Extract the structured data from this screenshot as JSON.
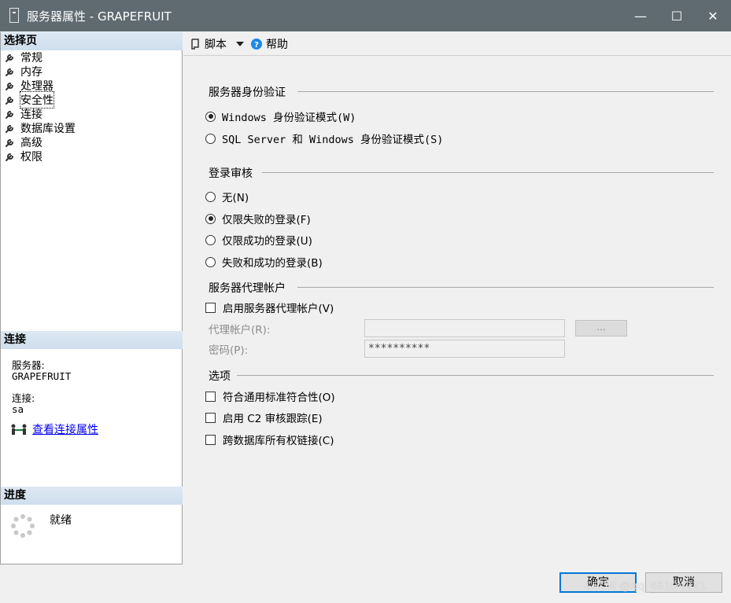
{
  "window": {
    "title": "服务器属性 - GRAPEFRUIT",
    "controls": {
      "minimize": "—",
      "maximize": "☐",
      "close": "✕"
    }
  },
  "left": {
    "select_page_header": "选择页",
    "pages": [
      {
        "label": "常规",
        "icon": "wrench-icon"
      },
      {
        "label": "内存",
        "icon": "wrench-icon"
      },
      {
        "label": "处理器",
        "icon": "wrench-icon"
      },
      {
        "label": "安全性",
        "icon": "wrench-icon",
        "selected": true
      },
      {
        "label": "连接",
        "icon": "wrench-icon"
      },
      {
        "label": "数据库设置",
        "icon": "wrench-icon"
      },
      {
        "label": "高级",
        "icon": "wrench-icon"
      },
      {
        "label": "权限",
        "icon": "wrench-icon"
      }
    ],
    "connection_header": "连接",
    "server_label": "服务器:",
    "server_value": "GRAPEFRUIT",
    "connection_label": "连接:",
    "connection_value": "sa",
    "view_connection_link": "查看连接属性",
    "progress_header": "进度",
    "progress_status": "就绪"
  },
  "toolbar": {
    "script_label": "脚本",
    "help_label": "帮助"
  },
  "security": {
    "auth_group": "服务器身份验证",
    "auth_options": [
      {
        "label": "Windows 身份验证模式(W)",
        "checked": true
      },
      {
        "label": "SQL Server 和 Windows 身份验证模式(S)",
        "checked": false
      }
    ],
    "audit_group": "登录审核",
    "audit_options": [
      {
        "label": "无(N)",
        "checked": false
      },
      {
        "label": "仅限失败的登录(F)",
        "checked": true
      },
      {
        "label": "仅限成功的登录(U)",
        "checked": false
      },
      {
        "label": "失败和成功的登录(B)",
        "checked": false
      }
    ],
    "proxy_group": "服务器代理帐户",
    "proxy_enable_label": "启用服务器代理帐户(V)",
    "proxy_account_label": "代理帐户(R):",
    "proxy_account_value": "",
    "browse_label": "...",
    "password_label": "密码(P):",
    "password_value": "**********",
    "options_group": "选项",
    "options": [
      {
        "label": "符合通用标准符合性(O)",
        "checked": false
      },
      {
        "label": "启用 C2 审核跟踪(E)",
        "checked": false
      },
      {
        "label": "跨数据库所有权链接(C)",
        "checked": false
      }
    ]
  },
  "footer": {
    "ok_label": "确定",
    "cancel_label": "取消",
    "watermark": "CSDN @qq_46104221"
  }
}
